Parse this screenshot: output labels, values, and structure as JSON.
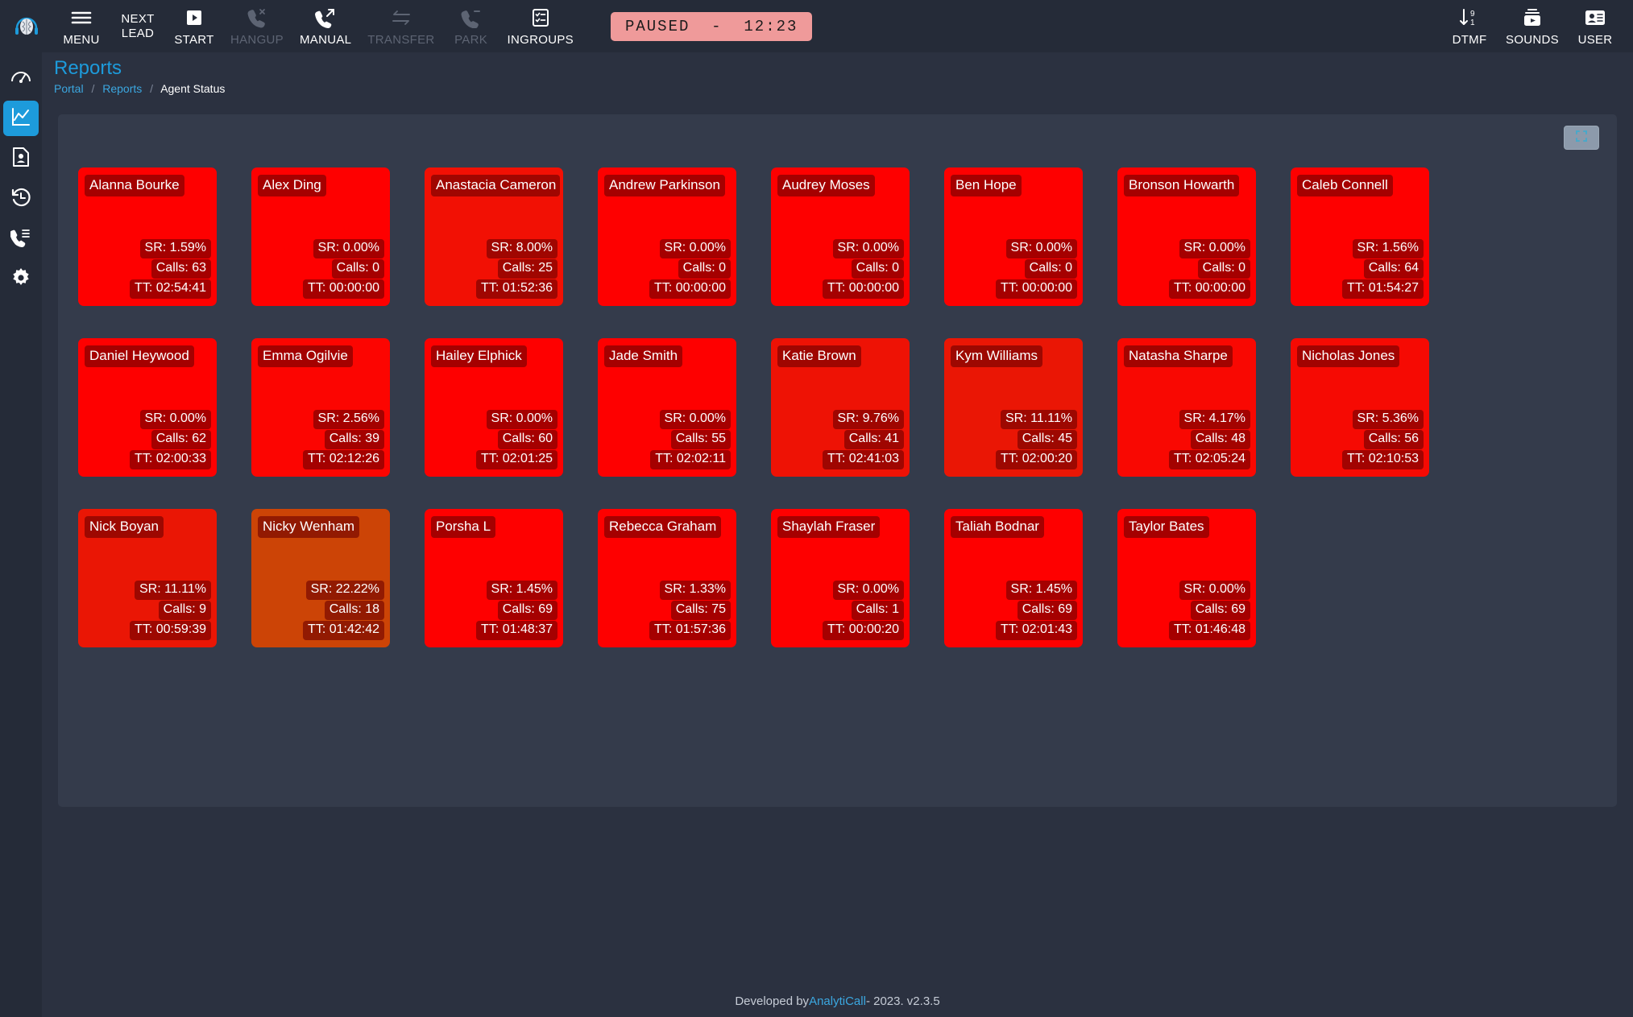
{
  "topbar": {
    "logo_icon": "brain-headset-logo",
    "items": [
      {
        "id": "menu",
        "label": "MENU",
        "icon": "hamburger-icon",
        "disabled": false,
        "twoline": false
      },
      {
        "id": "next-lead",
        "label": "NEXT\nLEAD",
        "icon": "text-only",
        "disabled": false,
        "twoline": true
      },
      {
        "id": "start",
        "label": "START",
        "icon": "play-box-icon",
        "disabled": false,
        "twoline": false
      },
      {
        "id": "hangup",
        "label": "HANGUP",
        "icon": "phone-hangup-icon",
        "disabled": true,
        "twoline": false
      },
      {
        "id": "manual",
        "label": "MANUAL",
        "icon": "phone-outgoing-icon",
        "disabled": false,
        "twoline": false
      },
      {
        "id": "transfer",
        "label": "TRANSFER",
        "icon": "transfer-arrows-icon",
        "disabled": true,
        "twoline": false
      },
      {
        "id": "park",
        "label": "PARK",
        "icon": "phone-park-icon",
        "disabled": true,
        "twoline": false
      },
      {
        "id": "ingroups",
        "label": "INGROUPS",
        "icon": "checklist-icon",
        "disabled": false,
        "twoline": false
      }
    ],
    "status_badge": "PAUSED  -  12:23",
    "status_badge_color": "#ef9a9a",
    "right_items": [
      {
        "id": "dtmf",
        "label": "DTMF",
        "icon": "dtmf-arrow-91-icon"
      },
      {
        "id": "sounds",
        "label": "SOUNDS",
        "icon": "sounds-play-icon"
      },
      {
        "id": "user",
        "label": "USER",
        "icon": "user-card-icon"
      }
    ]
  },
  "sidebar": {
    "active_color": "#1d9bdb",
    "items": [
      {
        "id": "dashboard",
        "icon": "gauge-dashboard-icon",
        "active": false
      },
      {
        "id": "reports",
        "icon": "line-chart-icon",
        "active": true
      },
      {
        "id": "leads",
        "icon": "contact-document-icon",
        "active": false
      },
      {
        "id": "history",
        "icon": "history-clock-icon",
        "active": false
      },
      {
        "id": "call-list",
        "icon": "phone-list-icon",
        "active": false
      },
      {
        "id": "settings",
        "icon": "gear-icon",
        "active": false
      }
    ]
  },
  "page": {
    "title": "Reports",
    "breadcrumb": {
      "portal": "Portal",
      "reports": "Reports",
      "current": "Agent Status",
      "separator": "/"
    },
    "fullscreen_icon": "fullscreen-expand-icon"
  },
  "agents": {
    "stat_labels": {
      "sr": "SR:",
      "calls": "Calls:",
      "tt": "TT:"
    },
    "rows": [
      [
        {
          "name": "Alanna Bourke",
          "sr": "SR: 1.59%",
          "calls": "Calls: 63",
          "tt": "TT: 02:54:41",
          "color": "#fe0000"
        },
        {
          "name": "Alex Ding",
          "sr": "SR: 0.00%",
          "calls": "Calls: 0",
          "tt": "TT: 00:00:00",
          "color": "#fe0000"
        },
        {
          "name": "Anastacia Cameron",
          "sr": "SR: 8.00%",
          "calls": "Calls: 25",
          "tt": "TT: 01:52:36",
          "color": "#f21004"
        },
        {
          "name": "Andrew Parkinson",
          "sr": "SR: 0.00%",
          "calls": "Calls: 0",
          "tt": "TT: 00:00:00",
          "color": "#fe0000"
        },
        {
          "name": "Audrey Moses",
          "sr": "SR: 0.00%",
          "calls": "Calls: 0",
          "tt": "TT: 00:00:00",
          "color": "#fe0000"
        },
        {
          "name": "Ben Hope",
          "sr": "SR: 0.00%",
          "calls": "Calls: 0",
          "tt": "TT: 00:00:00",
          "color": "#fe0000"
        },
        {
          "name": "Bronson Howarth",
          "sr": "SR: 0.00%",
          "calls": "Calls: 0",
          "tt": "TT: 00:00:00",
          "color": "#fe0000"
        },
        {
          "name": "Caleb Connell",
          "sr": "SR: 1.56%",
          "calls": "Calls: 64",
          "tt": "TT: 01:54:27",
          "color": "#fe0000"
        }
      ],
      [
        {
          "name": "Daniel Heywood",
          "sr": "SR: 0.00%",
          "calls": "Calls: 62",
          "tt": "TT: 02:00:33",
          "color": "#fe0000"
        },
        {
          "name": "Emma Ogilvie",
          "sr": "SR: 2.56%",
          "calls": "Calls: 39",
          "tt": "TT: 02:12:26",
          "color": "#fc0501"
        },
        {
          "name": "Hailey Elphick",
          "sr": "SR: 0.00%",
          "calls": "Calls: 60",
          "tt": "TT: 02:01:25",
          "color": "#fe0000"
        },
        {
          "name": "Jade Smith",
          "sr": "SR: 0.00%",
          "calls": "Calls: 55",
          "tt": "TT: 02:02:11",
          "color": "#fe0000"
        },
        {
          "name": "Katie Brown",
          "sr": "SR: 9.76%",
          "calls": "Calls: 41",
          "tt": "TT: 02:41:03",
          "color": "#ee1205"
        },
        {
          "name": "Kym Williams",
          "sr": "SR: 11.11%",
          "calls": "Calls: 45",
          "tt": "TT: 02:00:20",
          "color": "#ea1605"
        },
        {
          "name": "Natasha Sharpe",
          "sr": "SR: 4.17%",
          "calls": "Calls: 48",
          "tt": "TT: 02:05:24",
          "color": "#f90802"
        },
        {
          "name": "Nicholas Jones",
          "sr": "SR: 5.36%",
          "calls": "Calls: 56",
          "tt": "TT: 02:10:53",
          "color": "#f60a03"
        }
      ],
      [
        {
          "name": "Nick Boyan",
          "sr": "SR: 11.11%",
          "calls": "Calls: 9",
          "tt": "TT: 00:59:39",
          "color": "#ea1605"
        },
        {
          "name": "Nicky Wenham",
          "sr": "SR: 22.22%",
          "calls": "Calls: 18",
          "tt": "TT: 01:42:42",
          "color": "#cc4406"
        },
        {
          "name": "Porsha L",
          "sr": "SR: 1.45%",
          "calls": "Calls: 69",
          "tt": "TT: 01:48:37",
          "color": "#fe0000"
        },
        {
          "name": "Rebecca Graham",
          "sr": "SR: 1.33%",
          "calls": "Calls: 75",
          "tt": "TT: 01:57:36",
          "color": "#fe0000"
        },
        {
          "name": "Shaylah Fraser",
          "sr": "SR: 0.00%",
          "calls": "Calls: 1",
          "tt": "TT: 00:00:20",
          "color": "#fe0000"
        },
        {
          "name": "Taliah Bodnar",
          "sr": "SR: 1.45%",
          "calls": "Calls: 69",
          "tt": "TT: 02:01:43",
          "color": "#fe0000"
        },
        {
          "name": "Taylor Bates",
          "sr": "SR: 0.00%",
          "calls": "Calls: 69",
          "tt": "TT: 01:46:48",
          "color": "#fe0000"
        }
      ]
    ]
  },
  "footer": {
    "prefix": "Developed by ",
    "brand": "AnalytiCall",
    "suffix": " - 2023. v2.3.5"
  }
}
